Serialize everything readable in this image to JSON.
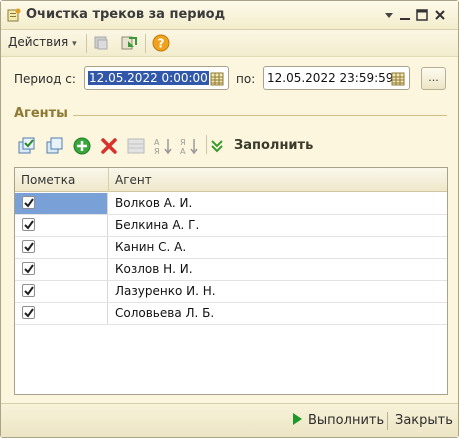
{
  "window": {
    "title": "Очистка треков за период"
  },
  "toolbar": {
    "actions_label": "Действия",
    "actions_arrow": "▾"
  },
  "period": {
    "from_label": "Период с:",
    "from_value": "12.05.2022  0:00:00",
    "to_label": "по:",
    "to_value": "12.05.2022 23:59:59",
    "choose_label": "..."
  },
  "agents": {
    "group_title": "Агенты",
    "fill_label": "Заполнить",
    "columns": [
      "Пометка",
      "Агент"
    ],
    "rows": [
      {
        "checked": true,
        "name": "Волков А. И."
      },
      {
        "checked": true,
        "name": "Белкина А. Г."
      },
      {
        "checked": true,
        "name": "Канин С. А."
      },
      {
        "checked": true,
        "name": "Козлов Н. И."
      },
      {
        "checked": true,
        "name": "Лазуренко И. Н."
      },
      {
        "checked": true,
        "name": "Соловьева Л. Б."
      }
    ]
  },
  "footer": {
    "run_label": "Выполнить",
    "close_label": "Закрыть"
  },
  "colors": {
    "accent": "#8c7a35",
    "selection": "#3157a8",
    "active_cell": "#7aa0d8",
    "run_green": "#1e9a2a",
    "delete_red": "#d9312b"
  }
}
